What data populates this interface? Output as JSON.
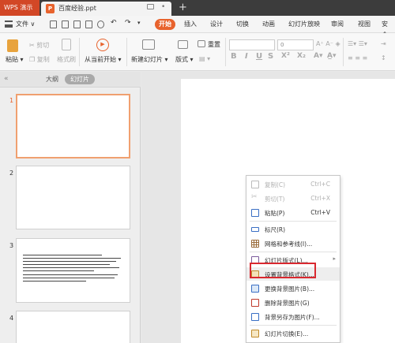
{
  "app": {
    "name": "WPS 演示"
  },
  "tabs": [
    {
      "title": "百度经验.ppt"
    }
  ],
  "menu": {
    "file_label": "文件",
    "tabs": [
      "开始",
      "插入",
      "设计",
      "切换",
      "动画",
      "幻灯片放映",
      "审阅",
      "视图",
      "安全"
    ],
    "active_tab": "开始"
  },
  "ribbon": {
    "paste": "粘贴",
    "cut": "剪切",
    "copy": "复制",
    "format_painter": "格式刷",
    "from_current": "从当前开始",
    "new_slide": "新建幻灯片",
    "layout": "版式",
    "reset": "重置",
    "font_size": "0"
  },
  "left_pane": {
    "outline_tab": "大纲",
    "slides_tab": "幻灯片",
    "slide_numbers": [
      "1",
      "2",
      "3",
      "4"
    ]
  },
  "context_menu": {
    "items": [
      {
        "label": "复制(C)",
        "shortcut": "Ctrl+C",
        "enabled": false,
        "icon": "copy-icon"
      },
      {
        "label": "剪切(T)",
        "shortcut": "Ctrl+X",
        "enabled": false,
        "icon": "cut-icon"
      },
      {
        "label": "粘贴(P)",
        "shortcut": "Ctrl+V",
        "enabled": true,
        "icon": "paste-icon"
      },
      {
        "label": "标尺(R)",
        "shortcut": "",
        "enabled": true,
        "icon": "ruler-icon"
      },
      {
        "label": "网格和参考线(I)...",
        "shortcut": "",
        "enabled": true,
        "icon": "grid-icon"
      },
      {
        "label": "幻灯片版式(L)...",
        "shortcut": "",
        "enabled": true,
        "icon": "layout-icon",
        "submenu": true
      },
      {
        "label": "设置背景格式(K)...",
        "shortcut": "",
        "enabled": true,
        "icon": "background-format-icon",
        "highlighted": true
      },
      {
        "label": "更换背景图片(B)...",
        "shortcut": "",
        "enabled": true,
        "icon": "change-background-icon"
      },
      {
        "label": "删除背景图片(G)",
        "shortcut": "",
        "enabled": true,
        "icon": "delete-background-icon"
      },
      {
        "label": "背景另存为图片(F)...",
        "shortcut": "",
        "enabled": true,
        "icon": "save-background-icon"
      },
      {
        "label": "幻灯片切换(E)...",
        "shortcut": "",
        "enabled": true,
        "icon": "transition-icon"
      }
    ]
  },
  "colors": {
    "accent": "#e8632d",
    "highlight_border": "#d9282f"
  }
}
